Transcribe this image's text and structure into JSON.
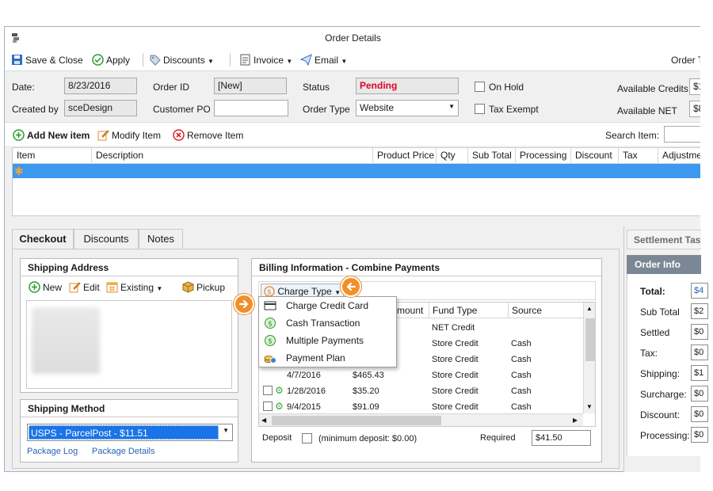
{
  "window": {
    "title": "Order Details"
  },
  "toolbar": {
    "save_close": "Save & Close",
    "apply": "Apply",
    "discounts": "Discounts",
    "invoice": "Invoice",
    "email": "Email",
    "order_t": "Order T"
  },
  "form": {
    "date_label": "Date:",
    "date_value": "8/23/2016",
    "order_id_label": "Order ID",
    "order_id_value": "[New]",
    "status_label": "Status",
    "status_value": "Pending",
    "on_hold_label": "On Hold",
    "available_credits_label": "Available Credits",
    "available_credits_value": "$1",
    "created_by_label": "Created by",
    "created_by_value": "sceDesign",
    "customer_po_label": "Customer PO",
    "customer_po_value": "",
    "order_type_label": "Order Type",
    "order_type_value": "Website",
    "tax_exempt_label": "Tax Exempt",
    "available_net_label": "Available NET",
    "available_net_value": "$8"
  },
  "items": {
    "add": "Add New item",
    "modify": "Modify Item",
    "remove": "Remove Item",
    "search_label": "Search Item:",
    "columns": [
      "Item",
      "Description",
      "Product Price",
      "Qty",
      "Sub Total",
      "Processing",
      "Discount",
      "Tax",
      "Adjustme"
    ],
    "new_row_marker": "✱"
  },
  "tabs": [
    "Checkout",
    "Discounts",
    "Notes"
  ],
  "shipping_address": {
    "title": "Shipping Address",
    "new": "New",
    "edit": "Edit",
    "existing": "Existing",
    "pickup": "Pickup"
  },
  "shipping_method": {
    "title": "Shipping Method",
    "selected": "USPS - ParcelPost - $11.51",
    "package_log": "Package Log",
    "package_details": "Package Details"
  },
  "billing": {
    "title": "Billing Information - Combine Payments",
    "charge_type": "Charge Type",
    "columns": [
      "mount",
      "Fund Type",
      "Source"
    ],
    "rows": [
      {
        "date": "",
        "amount": "",
        "fund_type": "NET Credit",
        "source": ""
      },
      {
        "date": "",
        "amount": "",
        "fund_type": "Store Credit",
        "source": "Cash"
      },
      {
        "date": "",
        "amount": "",
        "fund_type": "Store Credit",
        "source": "Cash"
      },
      {
        "date": "4/7/2016",
        "amount": "$465.43",
        "fund_type": "Store Credit",
        "source": "Cash"
      },
      {
        "date": "1/28/2016",
        "amount": "$35.20",
        "fund_type": "Store Credit",
        "source": "Cash"
      },
      {
        "date": "9/4/2015",
        "amount": "$91.09",
        "fund_type": "Store Credit",
        "source": "Cash"
      }
    ],
    "deposit_label": "Deposit",
    "min_deposit": "(minimum deposit: $0.00)",
    "required_label": "Required",
    "required_value": "$41.50"
  },
  "charge_menu": {
    "items": [
      "Charge Credit Card",
      "Cash Transaction",
      "Multiple Payments",
      "Payment Plan"
    ]
  },
  "settlement": {
    "tab": "Settlement Tas",
    "order_info": "Order Info",
    "total_label": "Total:",
    "total_value": "$4",
    "rows": [
      {
        "label": "Sub Total",
        "value": "$2"
      },
      {
        "label": "Settled",
        "value": "$0"
      },
      {
        "label": "Tax:",
        "value": "$0"
      },
      {
        "label": "Shipping:",
        "value": "$1"
      },
      {
        "label": "Surcharge:",
        "value": "$0"
      },
      {
        "label": "Discount:",
        "value": "$0"
      },
      {
        "label": "Processing:",
        "value": "$0"
      }
    ]
  },
  "colors": {
    "selection": "#3d98f0",
    "status": "#e0002a",
    "orange": "#f0902b",
    "link": "#2a62b8",
    "order_info_header": "#7b8794"
  }
}
